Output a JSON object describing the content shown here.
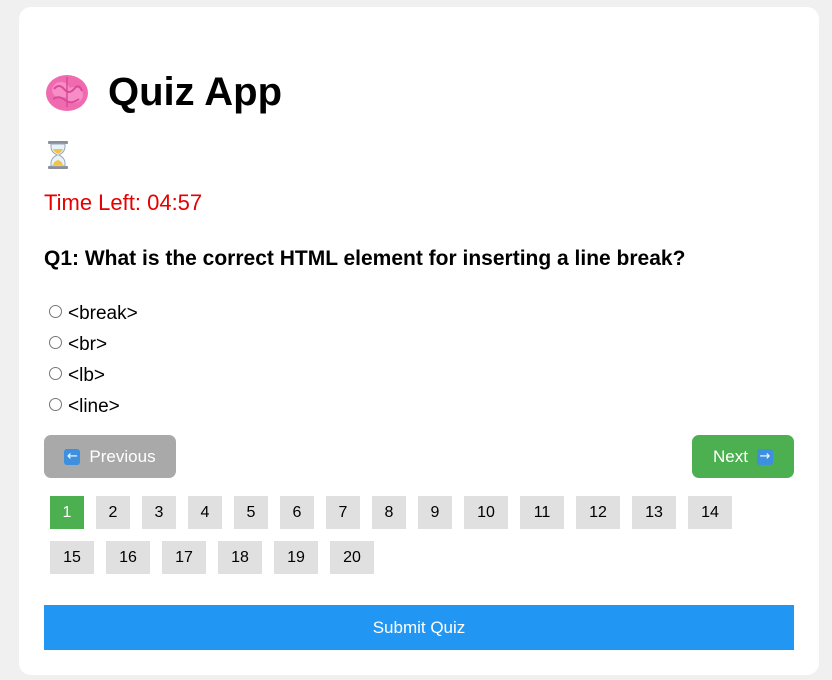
{
  "app": {
    "title": "Quiz App",
    "brain_icon": "brain-icon",
    "hourglass_icon": "hourglass-icon"
  },
  "timer": {
    "text": "Time Left: 04:57",
    "color": "#e60000"
  },
  "question": {
    "text": "Q1: What is the correct HTML element for inserting a line break?",
    "options": [
      "<break>",
      "<br>",
      "<lb>",
      "<line>"
    ]
  },
  "navigation": {
    "previous_label": "Previous",
    "next_label": "Next",
    "previous_icon": "left-arrow-icon",
    "next_icon": "right-arrow-icon",
    "previous_color": "#a9a9a9",
    "next_color": "#4caf50"
  },
  "pages": {
    "row1": [
      "1",
      "2",
      "3",
      "4",
      "5",
      "6",
      "7",
      "8",
      "9",
      "10",
      "11",
      "12",
      "13",
      "14"
    ],
    "row2": [
      "15",
      "16",
      "17",
      "18",
      "19",
      "20"
    ],
    "active": "1",
    "active_color": "#4caf50"
  },
  "submit": {
    "label": "Submit Quiz",
    "color": "#2196f3"
  }
}
